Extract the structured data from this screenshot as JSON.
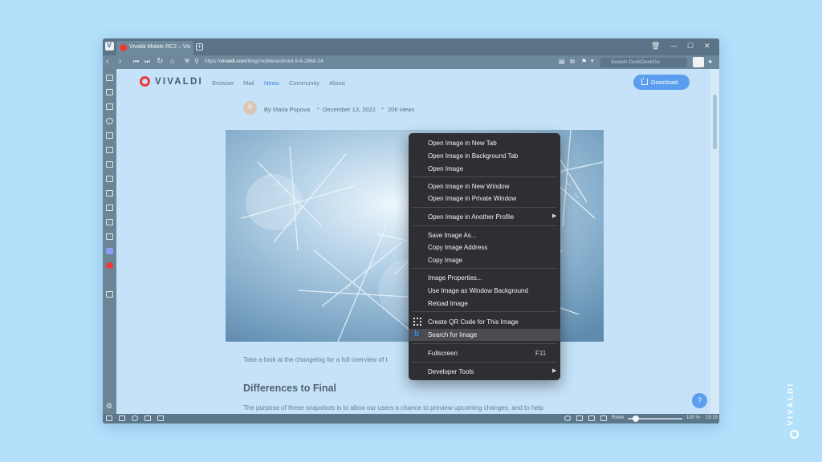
{
  "tabbar": {
    "tab_title": "Vivaldi Mobile RC2 – Vivaldi"
  },
  "addressbar": {
    "url_prefix": "https://",
    "url_domain": "vivaldi.com",
    "url_path": "/blog/mobile/android-5-6-2868-24",
    "search_placeholder": "Search DuckDuckGo"
  },
  "site": {
    "logo": "VIVALDI",
    "nav": [
      "Browser",
      "Mail",
      "News",
      "Community",
      "About"
    ],
    "active_nav": "News",
    "download_label": "Download",
    "accent_color": "#ef3939",
    "link_color": "#3f7fd6"
  },
  "article": {
    "author": "By Maria Popova",
    "date": "December 13, 2022",
    "views": "206 views",
    "paragraph1": "Take a look at the changelog for a full overview of t",
    "heading": "Differences to Final",
    "paragraph2": "The purpose of these snapshots is to allow our users a chance to preview upcoming changes, and to help"
  },
  "context_menu": {
    "items": [
      {
        "label": "Open Image in New Tab"
      },
      {
        "label": "Open Image in Background Tab"
      },
      {
        "label": "Open Image"
      },
      {
        "label": "Open Image in New Window"
      },
      {
        "label": "Open Image in Private Window"
      },
      {
        "label": "Open Image in Another Profile",
        "submenu": true
      },
      {
        "label": "Save Image As..."
      },
      {
        "label": "Copy Image Address"
      },
      {
        "label": "Copy Image"
      },
      {
        "label": "Image Properties..."
      },
      {
        "label": "Use Image as Window Background"
      },
      {
        "label": "Reload Image"
      },
      {
        "label": "Create QR Code for This Image",
        "icon": "qr-code-icon"
      },
      {
        "label": "Search for Image",
        "icon": "bing-icon",
        "highlighted": true
      },
      {
        "label": "Fullscreen",
        "shortcut": "F11"
      },
      {
        "label": "Developer Tools",
        "submenu": true
      }
    ]
  },
  "statusbar": {
    "reset": "Reset",
    "zoom": "100 %",
    "time": "15:19"
  },
  "help_label": "?",
  "brand": "VIVALDI"
}
